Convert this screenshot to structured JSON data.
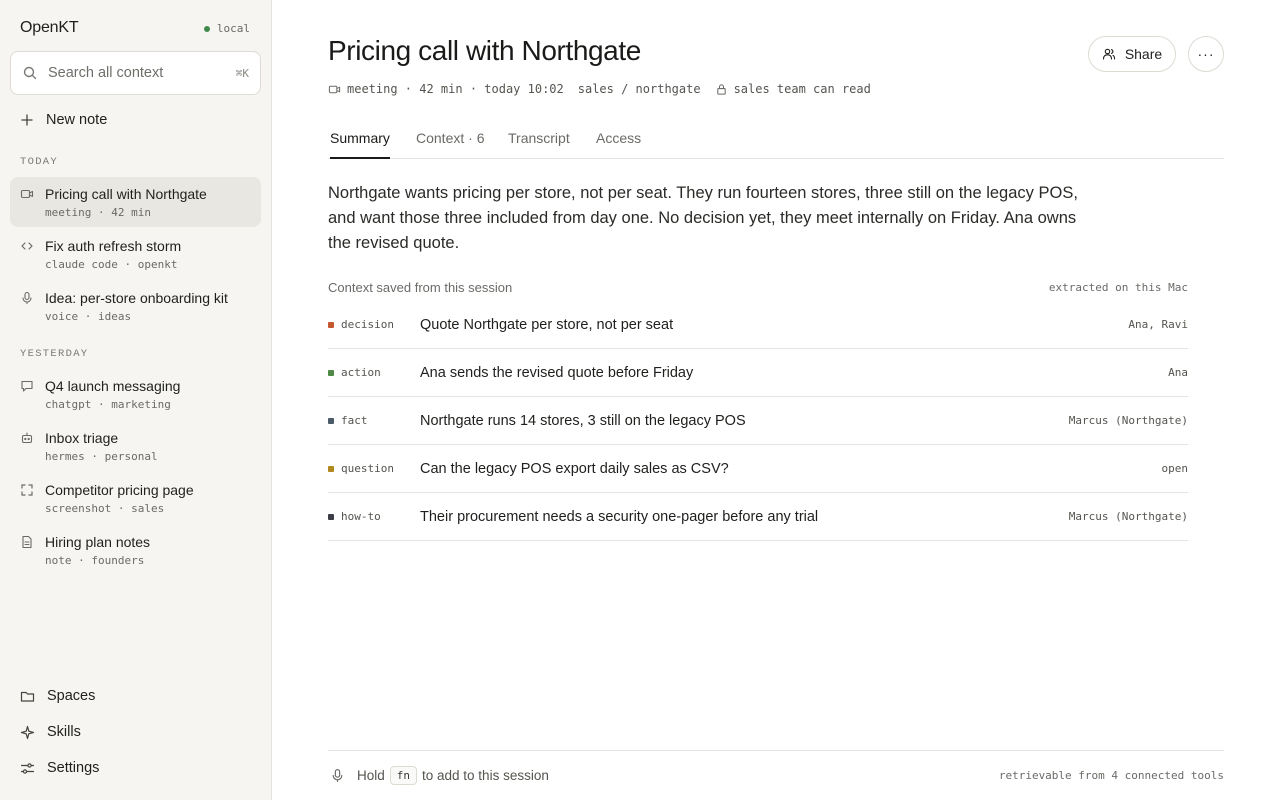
{
  "app": {
    "name": "OpenKT",
    "status": "local",
    "status_color": "#3f8a4a"
  },
  "search": {
    "placeholder": "Search all context",
    "shortcut": "⌘K"
  },
  "sidebar": {
    "new_note_label": "New note",
    "sections": [
      {
        "label": "TODAY",
        "items": [
          {
            "title": "Pricing call with Northgate",
            "meta": "meeting · 42 min",
            "icon": "video-icon",
            "active": true
          },
          {
            "title": "Fix auth refresh storm",
            "meta": "claude code · openkt",
            "icon": "code-icon"
          },
          {
            "title": "Idea: per-store onboarding kit",
            "meta": "voice · ideas",
            "icon": "microphone-icon"
          }
        ]
      },
      {
        "label": "YESTERDAY",
        "items": [
          {
            "title": "Q4 launch messaging",
            "meta": "chatgpt · marketing",
            "icon": "chat-bubble-icon"
          },
          {
            "title": "Inbox triage",
            "meta": "hermes · personal",
            "icon": "robot-icon"
          },
          {
            "title": "Competitor pricing page",
            "meta": "screenshot · sales",
            "icon": "screenshot-frame-icon"
          },
          {
            "title": "Hiring plan notes",
            "meta": "note · founders",
            "icon": "document-icon"
          }
        ]
      }
    ],
    "bottom": [
      {
        "label": "Spaces",
        "icon": "folder-icon"
      },
      {
        "label": "Skills",
        "icon": "sparkle-icon"
      },
      {
        "label": "Settings",
        "icon": "sliders-icon"
      }
    ]
  },
  "note": {
    "title": "Pricing call with Northgate",
    "meta": {
      "kind": "meeting · 42 min · today 10:02",
      "space": "sales / northgate",
      "access": "sales team can read"
    },
    "share_label": "Share",
    "more_label": "···",
    "tabs": [
      {
        "label": "Summary",
        "active": true
      },
      {
        "label": "Context · 6"
      },
      {
        "label": "Transcript"
      },
      {
        "label": "Access"
      }
    ],
    "summary": "Northgate wants pricing per store, not per seat. They run fourteen stores, three still on the legacy POS, and want those three included from day one. No decision yet, they meet internally on Friday. Ana owns the revised quote.",
    "context_heading": "Context saved from this session",
    "context_source": "extracted on this Mac",
    "context_items": [
      {
        "type": "decision",
        "color": "#c4572e",
        "text": "Quote Northgate per store, not per seat",
        "who": "Ana, Ravi"
      },
      {
        "type": "action",
        "color": "#4e8a45",
        "text": "Ana sends the revised quote before Friday",
        "who": "Ana"
      },
      {
        "type": "fact",
        "color": "#4a5a68",
        "text": "Northgate runs 14 stores, 3 still on the legacy POS",
        "who": "Marcus (Northgate)"
      },
      {
        "type": "question",
        "color": "#b08a1e",
        "text": "Can the legacy POS export daily sales as CSV?",
        "who": "open"
      },
      {
        "type": "how-to",
        "color": "#3a3d44",
        "text": "Their procurement needs a security one-pager before any trial",
        "who": "Marcus (Northgate)"
      }
    ]
  },
  "footer": {
    "hold": "Hold",
    "key": "fn",
    "rest": "to add to this session",
    "right": "retrievable from 4 connected tools"
  }
}
